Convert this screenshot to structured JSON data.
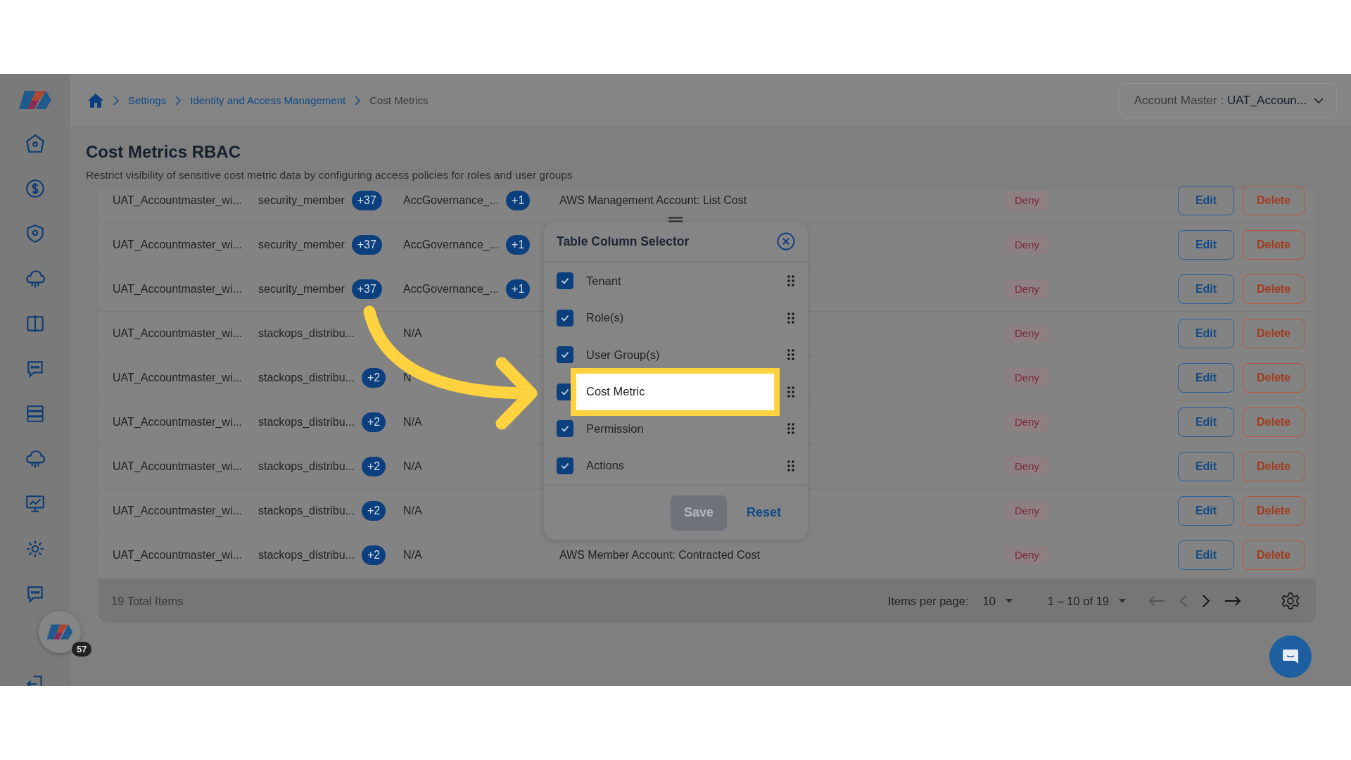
{
  "breadcrumb": [
    {
      "label": "Settings",
      "link": true
    },
    {
      "label": "Identity and Access Management",
      "link": true
    },
    {
      "label": "Cost Metrics",
      "link": false
    }
  ],
  "account_selector": {
    "label": "Account Master :",
    "value": "UAT_Accoun..."
  },
  "page": {
    "title": "Cost Metrics RBAC",
    "description": "Restrict visibility of sensitive cost metric data by configuring access policies for roles and user groups"
  },
  "table": {
    "rows": [
      {
        "tenant": "UAT_Accountmaster_wi...",
        "role": "security_member",
        "role_extra": "+37",
        "group": "AccGovernance_...",
        "group_extra": "+1",
        "cost_metric": "AWS Management Account: List Cost",
        "permission": "Deny",
        "actions": [
          "Edit",
          "Delete"
        ]
      },
      {
        "tenant": "UAT_Accountmaster_wi...",
        "role": "security_member",
        "role_extra": "+37",
        "group": "AccGovernance_...",
        "group_extra": "+1",
        "permission": "Deny",
        "actions": [
          "Edit",
          "Delete"
        ]
      },
      {
        "tenant": "UAT_Accountmaster_wi...",
        "role": "security_member",
        "role_extra": "+37",
        "group": "AccGovernance_...",
        "group_extra": "+1",
        "permission": "Deny",
        "actions": [
          "Edit",
          "Delete"
        ]
      },
      {
        "tenant": "UAT_Accountmaster_wi...",
        "role": "stackops_distribu...",
        "group": "N/A",
        "permission": "Deny",
        "actions": [
          "Edit",
          "Delete"
        ]
      },
      {
        "tenant": "UAT_Accountmaster_wi...",
        "role": "stackops_distribu...",
        "role_extra": "+2",
        "group": "N",
        "permission": "Deny",
        "actions": [
          "Edit",
          "Delete"
        ]
      },
      {
        "tenant": "UAT_Accountmaster_wi...",
        "role": "stackops_distribu...",
        "role_extra": "+2",
        "group": "N/A",
        "permission": "Deny",
        "actions": [
          "Edit",
          "Delete"
        ]
      },
      {
        "tenant": "UAT_Accountmaster_wi...",
        "role": "stackops_distribu...",
        "role_extra": "+2",
        "group": "N/A",
        "permission": "Deny",
        "actions": [
          "Edit",
          "Delete"
        ]
      },
      {
        "tenant": "UAT_Accountmaster_wi...",
        "role": "stackops_distribu...",
        "role_extra": "+2",
        "group": "N/A",
        "permission": "Deny",
        "actions": [
          "Edit",
          "Delete"
        ]
      },
      {
        "tenant": "UAT_Accountmaster_wi...",
        "role": "stackops_distribu...",
        "role_extra": "+2",
        "group": "N/A",
        "cost_metric": "AWS Member Account: Contracted Cost",
        "permission": "Deny",
        "actions": [
          "Edit",
          "Delete"
        ]
      }
    ]
  },
  "pagination": {
    "total": "19 Total Items",
    "per_page_label": "Items per page:",
    "per_page": "10",
    "range": "1 – 10 of 19"
  },
  "column_selector": {
    "title": "Table Column Selector",
    "columns": [
      {
        "label": "Tenant",
        "checked": true,
        "highlighted": false
      },
      {
        "label": "Role(s)",
        "checked": true,
        "highlighted": false
      },
      {
        "label": "User Group(s)",
        "checked": true,
        "highlighted": false
      },
      {
        "label": "Cost Metric",
        "checked": true,
        "highlighted": true
      },
      {
        "label": "Permission",
        "checked": true,
        "highlighted": false
      },
      {
        "label": "Actions",
        "checked": true,
        "highlighted": false
      }
    ],
    "buttons": [
      {
        "label": "Save",
        "disabled": true
      },
      {
        "label": "Reset",
        "disabled": false
      }
    ]
  },
  "notification_count": "57"
}
